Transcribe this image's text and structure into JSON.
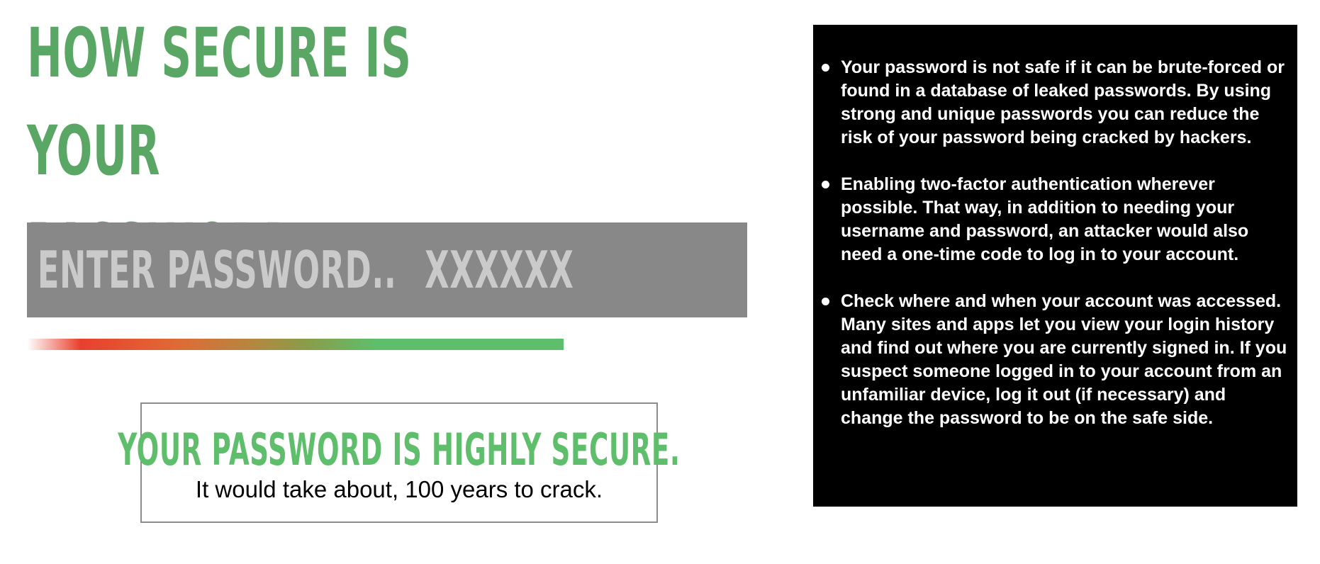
{
  "title": "HOW SECURE IS YOUR PASSWORD.",
  "password_input": {
    "label": "ENTER PASSWORD..",
    "value": "XXXXXX"
  },
  "strength_meter": {
    "level": 0.87
  },
  "result": {
    "heading": "YOUR PASSWORD IS HIGHLY SECURE.",
    "detail": "It would take about, 100 years to crack."
  },
  "tips": [
    "Your password is not safe if it can be brute-forced or found in a database of leaked passwords. By using strong and unique passwords you can reduce the risk of your password being cracked by hackers.",
    "Enabling two-factor authentication wherever possible. That way, in addition to needing your username and password, an attacker would also need a one-time code to log in to your account.",
    "Check where and when your account was accessed. Many sites and apps let you view your login history and find out where you are currently signed in. If you suspect someone logged in to your account from an unfamiliar device, log it out (if necessary) and change the password to be on the safe side."
  ],
  "colors": {
    "title_green": "#5aa664",
    "result_green": "#5fbe6b",
    "input_bg": "#888888",
    "input_text": "#cacaca",
    "tips_bg": "#000000"
  }
}
